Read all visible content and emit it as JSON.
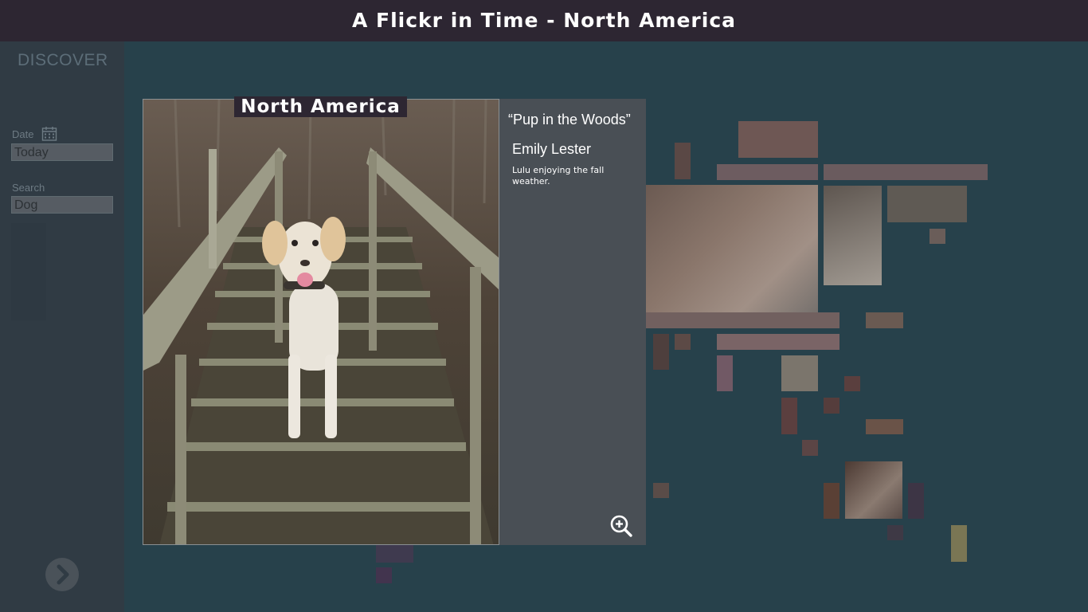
{
  "app": {
    "title": "A Flickr in Time - North America"
  },
  "sidebar": {
    "heading": "DISCOVER",
    "date_label": "Date",
    "date_value": "Today",
    "search_label": "Search",
    "search_value": "Dog",
    "next_icon": "chevron-right-icon"
  },
  "featured": {
    "region": "North America",
    "title": "“Pup in the Woods”",
    "author": "Emily Lester",
    "description": "Lulu enjoying the fall weather.",
    "zoom_icon": "zoom-in-icon"
  },
  "colors": {
    "background": "#27414b",
    "titlebar": "#2d2632",
    "sidebar": "#303b44",
    "info_panel": "#494f55"
  }
}
